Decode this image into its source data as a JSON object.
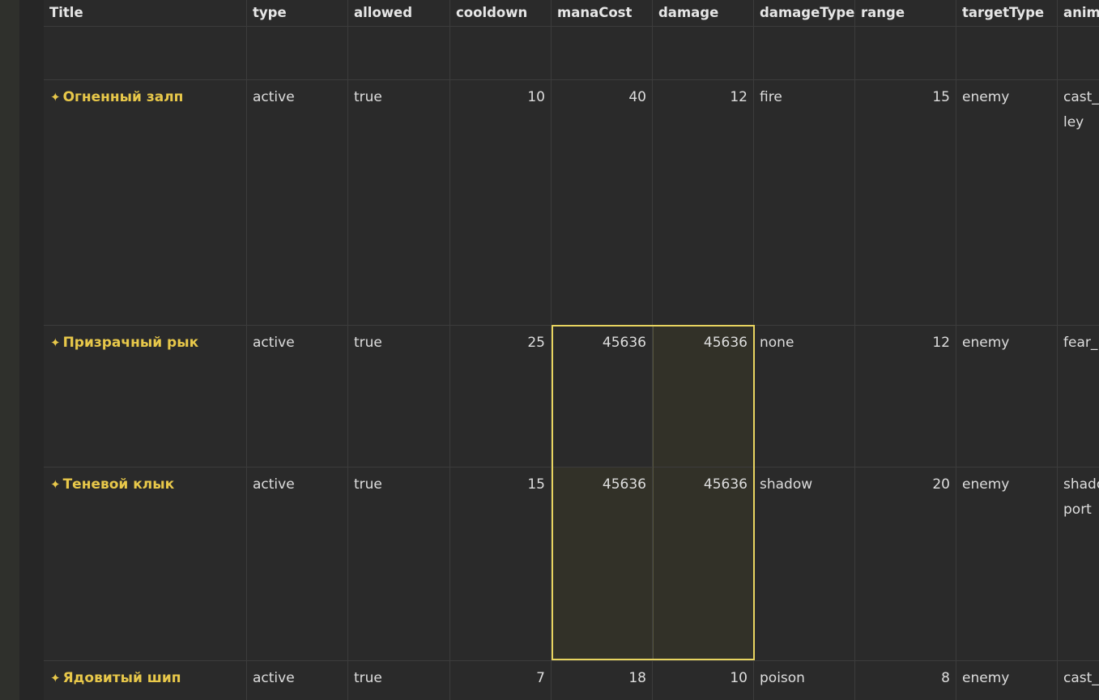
{
  "columns": [
    "Title",
    "type",
    "allowed",
    "cooldown",
    "manaCost",
    "damage",
    "damageType",
    "range",
    "targetType",
    "anim"
  ],
  "rows": [
    {
      "title": "Огненный залп",
      "type": "active",
      "allowed": "true",
      "cooldown": "10",
      "manaCost": "40",
      "damage": "12",
      "damageType": "fire",
      "range": "15",
      "targetType": "enemy",
      "anim": "cast_\nley"
    },
    {
      "title": "Призрачный рык",
      "type": "active",
      "allowed": "true",
      "cooldown": "25",
      "manaCost": "45636",
      "damage": "45636",
      "damageType": "none",
      "range": "12",
      "targetType": "enemy",
      "anim": "fear_"
    },
    {
      "title": "Теневой клык",
      "type": "active",
      "allowed": "true",
      "cooldown": "15",
      "manaCost": "45636",
      "damage": "45636",
      "damageType": "shadow",
      "range": "20",
      "targetType": "enemy",
      "anim": "shado\nport"
    },
    {
      "title": "Ядовитый шип",
      "type": "active",
      "allowed": "true",
      "cooldown": "7",
      "manaCost": "18",
      "damage": "10",
      "damageType": "poison",
      "range": "8",
      "targetType": "enemy",
      "anim": "cast_"
    }
  ],
  "icons": {
    "title_icon": "sparkles-icon",
    "title_glyph": "✦"
  },
  "colors": {
    "background": "#2a2a2a",
    "title_accent": "#e8c84a",
    "selection_border": "#e8d460",
    "gridline": "#3c3c3c"
  }
}
